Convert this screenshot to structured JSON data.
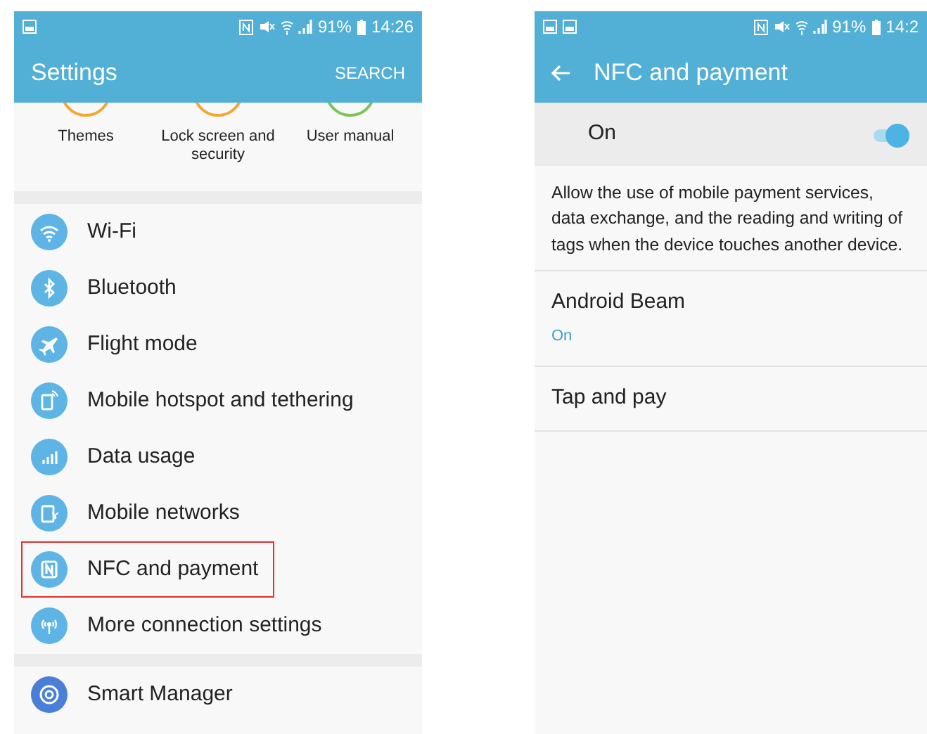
{
  "settings_screen": {
    "status_bar": {
      "battery": "91%",
      "time": "14:26"
    },
    "title": "Settings",
    "search_button": "SEARCH",
    "shortcuts": [
      {
        "label": "Themes",
        "color": "#f0a830"
      },
      {
        "label": "Lock screen and security",
        "color": "#f0a830"
      },
      {
        "label": "User manual",
        "color": "#7cc25a"
      }
    ],
    "connection_items": [
      {
        "label": "Wi-Fi",
        "highlighted": false
      },
      {
        "label": "Bluetooth",
        "highlighted": false
      },
      {
        "label": "Flight mode",
        "highlighted": false
      },
      {
        "label": "Mobile hotspot and tethering",
        "highlighted": false
      },
      {
        "label": "Data usage",
        "highlighted": false
      },
      {
        "label": "Mobile networks",
        "highlighted": false
      },
      {
        "label": "NFC and payment",
        "highlighted": true
      },
      {
        "label": "More connection settings",
        "highlighted": false
      }
    ],
    "device_items": [
      {
        "label": "Smart Manager"
      }
    ]
  },
  "nfc_screen": {
    "status_bar": {
      "battery": "91%",
      "time": "14:2"
    },
    "title": "NFC and payment",
    "master_switch": {
      "label": "On",
      "on": true
    },
    "description": "Allow the use of mobile payment services, data exchange, and the reading and writing of tags when the device touches another device.",
    "options": [
      {
        "title": "Android Beam",
        "summary": "On"
      },
      {
        "title": "Tap and pay"
      }
    ]
  }
}
